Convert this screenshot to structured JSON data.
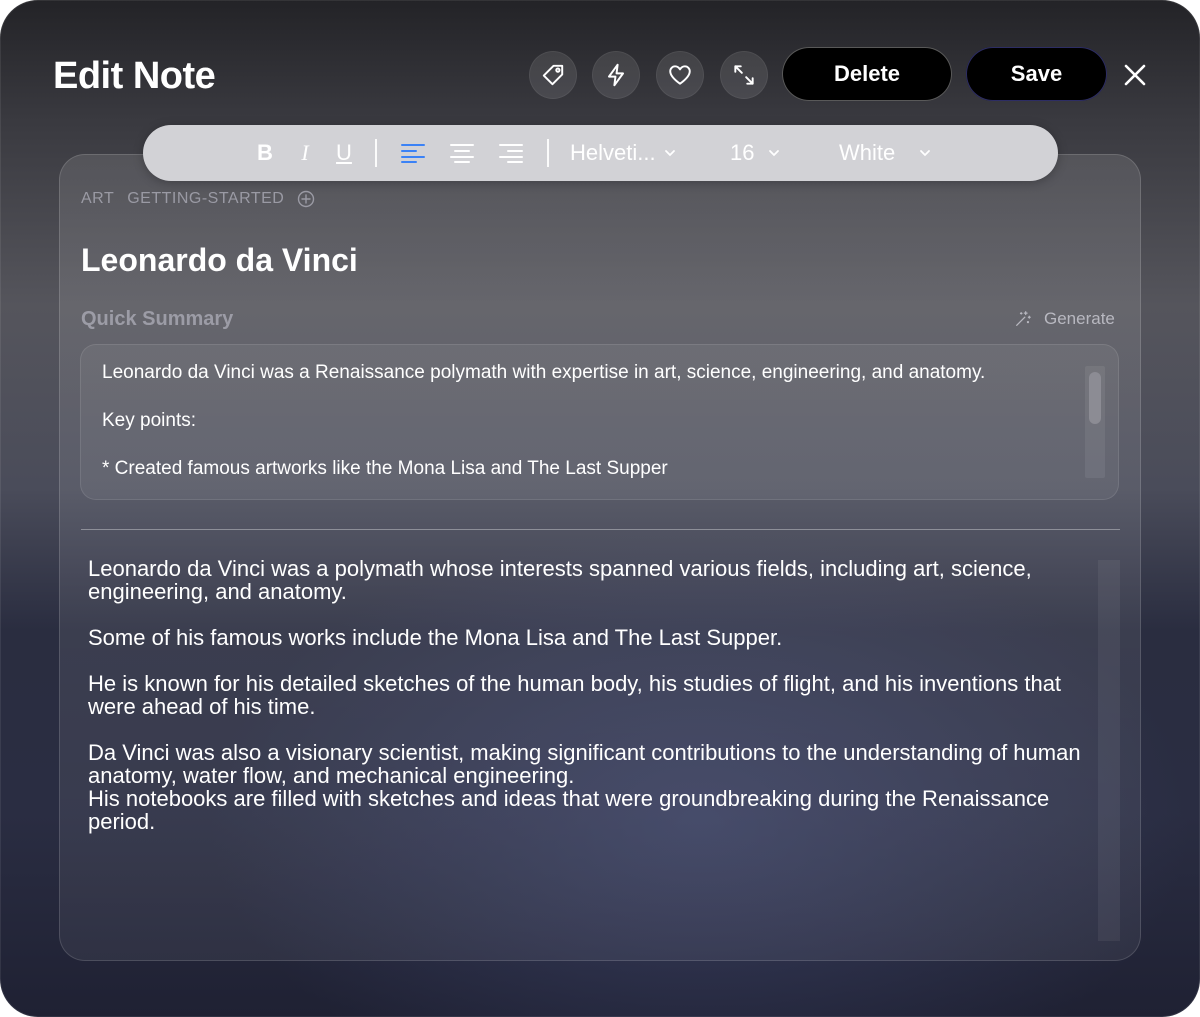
{
  "header": {
    "title": "Edit Note",
    "actions": [
      {
        "name": "tag",
        "icon": "tag-icon"
      },
      {
        "name": "quick",
        "icon": "bolt-icon"
      },
      {
        "name": "favorite",
        "icon": "heart-icon"
      },
      {
        "name": "expand",
        "icon": "expand-icon"
      }
    ],
    "delete_label": "Delete",
    "save_label": "Save",
    "close_icon": "close-icon"
  },
  "toolbar": {
    "bold": "B",
    "italic": "I",
    "underline": "U",
    "align_icons": [
      "align-left-icon",
      "align-center-icon",
      "align-right-icon"
    ],
    "active_align": "left",
    "font": "Helveti...",
    "size": "16",
    "color": "White"
  },
  "note": {
    "tags": [
      "ART",
      "GETTING-STARTED"
    ],
    "title": "Leonardo da Vinci",
    "summary_label": "Quick Summary",
    "generate_label": "Generate",
    "summary": "Leonardo da Vinci was a Renaissance polymath with expertise in art, science, engineering, and anatomy.\n\nKey points:\n\n* Created famous artworks like the Mona Lisa and The Last Supper",
    "body": "Leonardo da Vinci was a polymath whose interests spanned various fields, including art, science, engineering, and anatomy.\n\nSome of his famous works include the Mona Lisa and The Last Supper.\n\nHe is known for his detailed sketches of the human body, his studies of flight, and his inventions that were ahead of his time.\n\nDa Vinci was also a visionary scientist, making significant contributions to the understanding of human anatomy, water flow, and mechanical engineering.\nHis notebooks are filled with sketches and ideas that were groundbreaking during the Renaissance period."
  },
  "colors": {
    "accent": "#3b82f6",
    "primary_button": "#000000",
    "text": "#ffffff",
    "muted": "#9a9aa4"
  }
}
